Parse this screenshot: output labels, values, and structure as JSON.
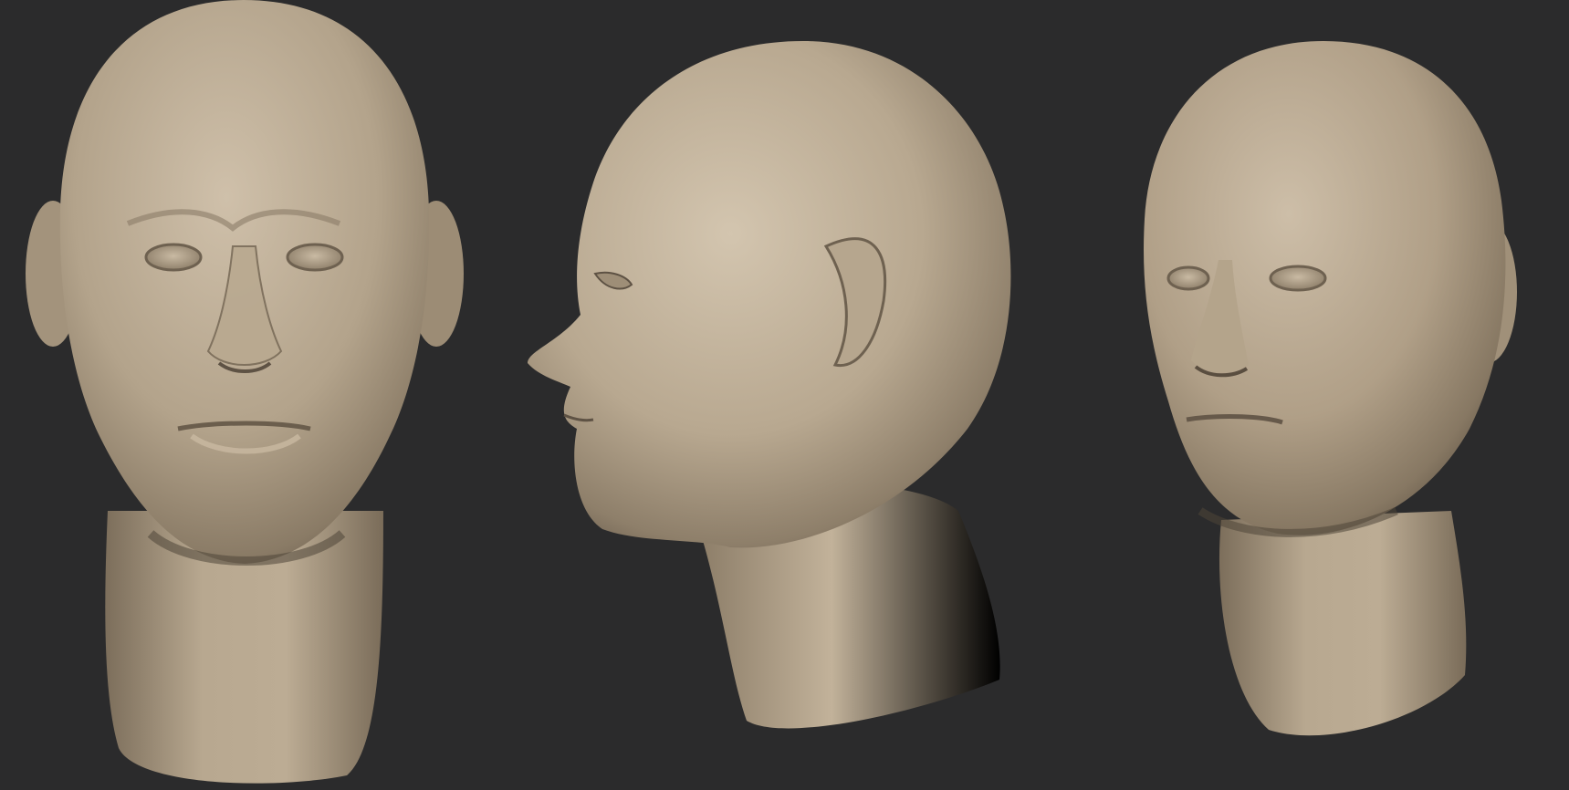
{
  "scene": {
    "background": "#2b2b2c",
    "material_light": "#cbbca6",
    "material_mid": "#a89880",
    "material_shadow": "#5e5244",
    "views": [
      "front",
      "profile-left",
      "three-quarter"
    ]
  }
}
